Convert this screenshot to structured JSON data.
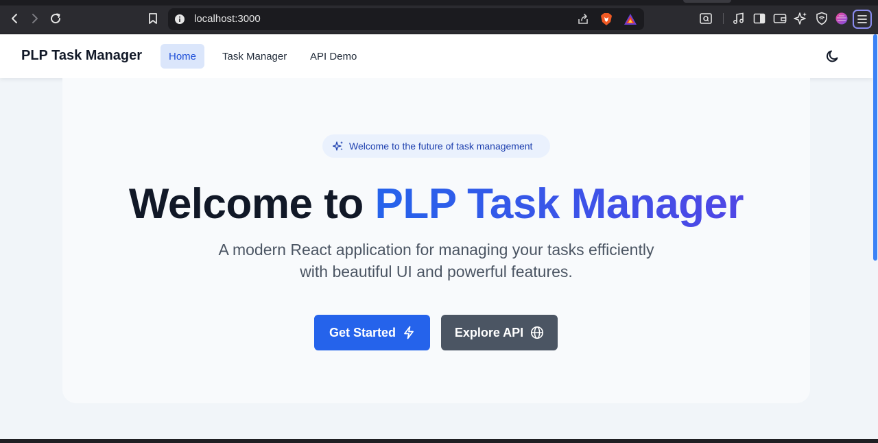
{
  "browser": {
    "url": "localhost:3000"
  },
  "header": {
    "brand": "PLP Task Manager",
    "nav": [
      {
        "label": "Home",
        "active": true
      },
      {
        "label": "Task Manager",
        "active": false
      },
      {
        "label": "API Demo",
        "active": false
      }
    ],
    "theme_toggle_icon": "moon-icon"
  },
  "hero": {
    "badge": "Welcome to the future of task management",
    "headline_prefix": "Welcome to",
    "headline_highlight": "PLP Task Manager",
    "subtitle_line1": "A modern React application for managing your tasks efficiently",
    "subtitle_line2": "with beautiful UI and powerful features.",
    "primary_button": {
      "label": "Get Started",
      "icon": "lightning-icon"
    },
    "secondary_button": {
      "label": "Explore API",
      "icon": "globe-icon"
    }
  },
  "colors": {
    "primary": "#2563eb",
    "secondary": "#4b5563",
    "gradient_end": "#4f46e5",
    "page_bg": "#f1f5f9"
  }
}
